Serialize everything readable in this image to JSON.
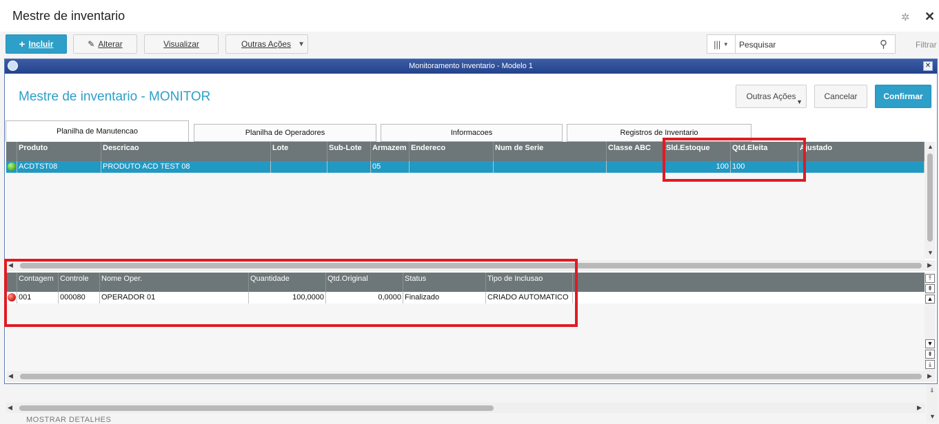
{
  "app": {
    "title": "Mestre de inventario",
    "filter_label": "Filtrar"
  },
  "toolbar": {
    "incluir_label": "Incluir",
    "alterar_label": "Alterar",
    "visualizar_label": "Visualizar",
    "outras_label": "Outras Ações"
  },
  "search": {
    "placeholder": "Pesquisar"
  },
  "dialog": {
    "title": "Monitoramento Inventario - Modelo 1",
    "heading": "Mestre de inventario - MONITOR",
    "outras_label": "Outras Ações",
    "cancel_label": "Cancelar",
    "confirm_label": "Confirmar"
  },
  "tabs": [
    {
      "label": "Planilha de Manutencao"
    },
    {
      "label": "Planilha de Operadores"
    },
    {
      "label": "Informacoes"
    },
    {
      "label": "Registros de Inventario"
    }
  ],
  "products_grid": {
    "columns": [
      "Produto",
      "Descricao",
      "Lote",
      "Sub-Lote",
      "Armazem",
      "Endereco",
      "Num de Serie",
      "Classe ABC",
      "Sld.Estoque",
      "Qtd.Eleita",
      "Ajustado"
    ],
    "rows": [
      {
        "produto": "ACDTST08",
        "descricao": "PRODUTO ACD TEST 08",
        "lote": "",
        "sub_lote": "",
        "armazem": "05",
        "endereco": "",
        "num_serie": "",
        "classe_abc": "",
        "sld_estoque": "100",
        "qtd_eleita": "100",
        "ajustado": "",
        "status_color": "#5bbf2a"
      }
    ]
  },
  "counts_grid": {
    "columns": [
      "Contagem",
      "Controle",
      "Nome Oper.",
      "Quantidade",
      "Qtd.Original",
      "Status",
      "Tipo de Inclusao"
    ],
    "rows": [
      {
        "contagem": "001",
        "controle": "000080",
        "nome_oper": "OPERADOR 01",
        "quantidade": "100,0000",
        "qtd_original": "0,0000",
        "status": "Finalizado",
        "tipo_inclusao": "CRIADO AUTOMATICO",
        "status_color": "#d7261e"
      }
    ]
  },
  "footer": {
    "details_label": "MOSTRAR DETALHES"
  },
  "colors": {
    "accent": "#2d9fc8",
    "highlight": "#e01a22",
    "grid_header": "#6d7678",
    "selected_row": "#2199c3"
  },
  "icons": [
    "gear-icon",
    "close-icon",
    "plus-icon",
    "pencil-icon",
    "columns-icon",
    "search-icon",
    "chevron-down-icon"
  ]
}
